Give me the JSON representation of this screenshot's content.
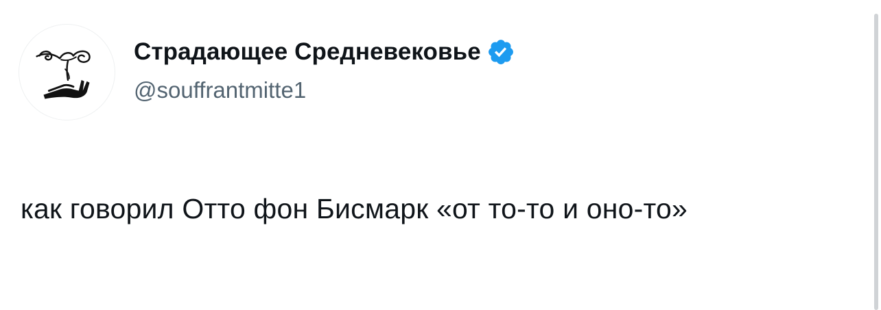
{
  "tweet": {
    "display_name": "Страдающее Средневековье",
    "handle": "@souffrantmitte1",
    "verified": true,
    "text": "как говорил Отто фон Бисмарк «от то-то и оно-то»"
  },
  "avatar": {
    "icon": "sprouting-seedling-in-hand-logo"
  },
  "colors": {
    "verified_badge": "#1d9bf0",
    "handle_text": "#536471",
    "primary_text": "#0f1419",
    "background": "#ffffff"
  }
}
